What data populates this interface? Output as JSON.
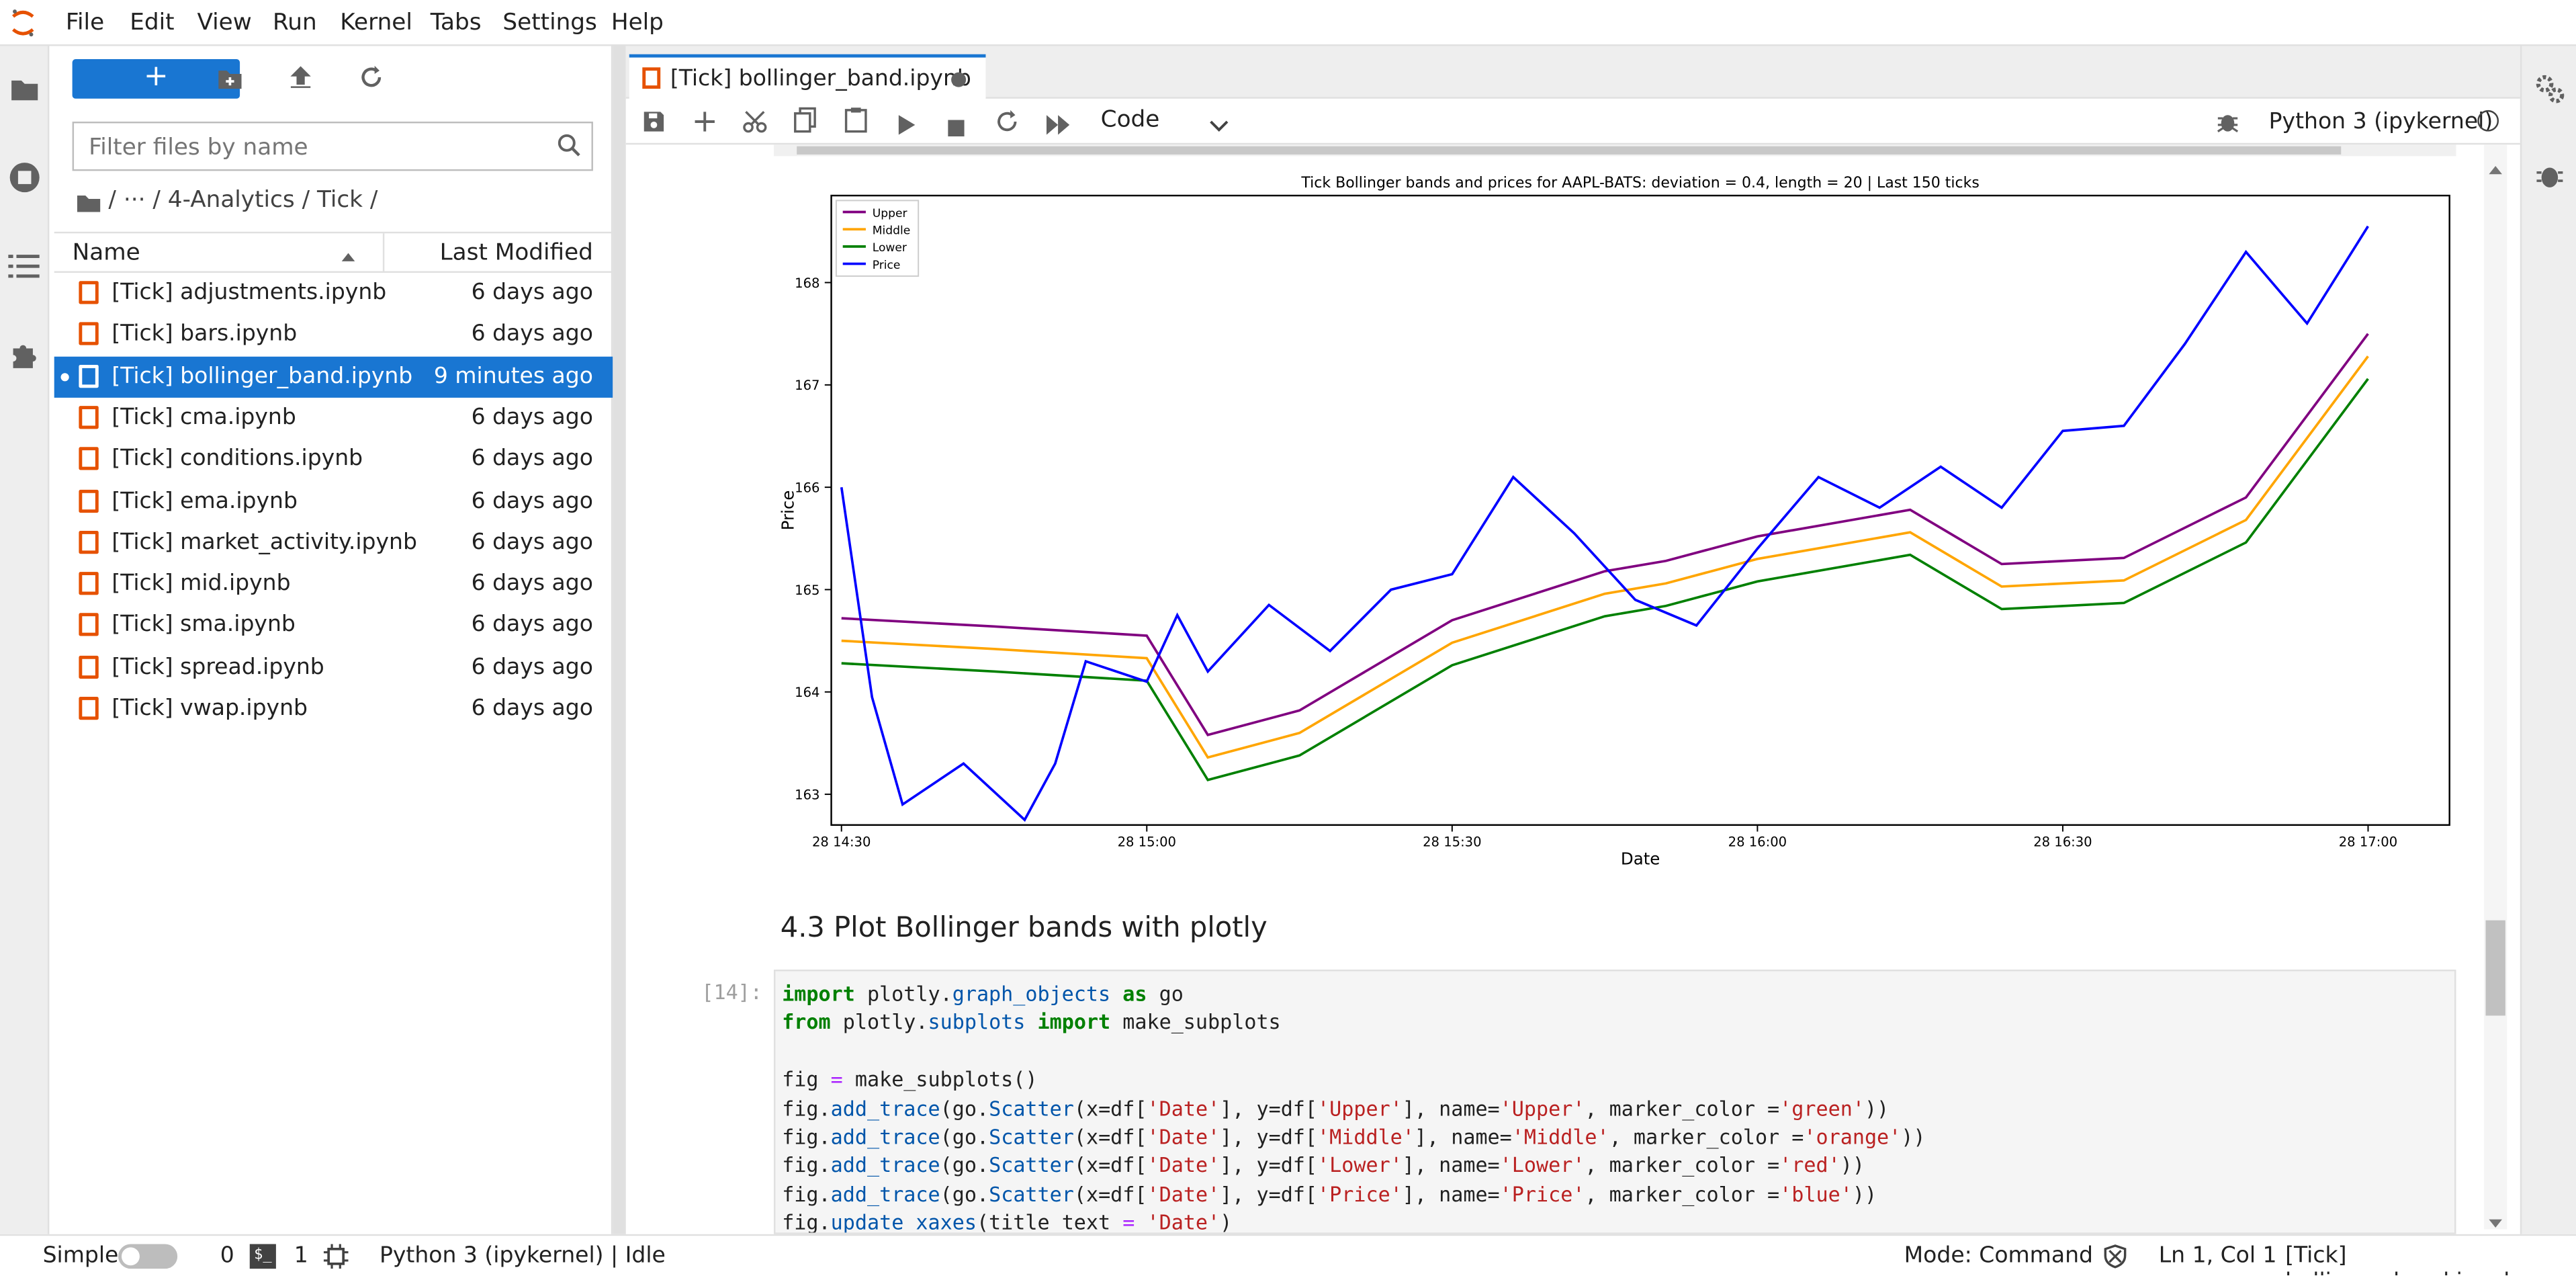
{
  "menu": [
    "File",
    "Edit",
    "View",
    "Run",
    "Kernel",
    "Tabs",
    "Settings",
    "Help"
  ],
  "filepanel": {
    "new_label": "+",
    "filter_placeholder": "Filter files by name",
    "breadcrumb": "/  ···  / 4-Analytics / Tick /",
    "col_name": "Name",
    "col_modified": "Last Modified",
    "files": [
      {
        "name": "[Tick] adjustments.ipynb",
        "modified": "6 days ago"
      },
      {
        "name": "[Tick] bars.ipynb",
        "modified": "6 days ago"
      },
      {
        "name": "[Tick] bollinger_band.ipynb",
        "modified": "9 minutes ago"
      },
      {
        "name": "[Tick] cma.ipynb",
        "modified": "6 days ago"
      },
      {
        "name": "[Tick] conditions.ipynb",
        "modified": "6 days ago"
      },
      {
        "name": "[Tick] ema.ipynb",
        "modified": "6 days ago"
      },
      {
        "name": "[Tick] market_activity.ipynb",
        "modified": "6 days ago"
      },
      {
        "name": "[Tick] mid.ipynb",
        "modified": "6 days ago"
      },
      {
        "name": "[Tick] sma.ipynb",
        "modified": "6 days ago"
      },
      {
        "name": "[Tick] spread.ipynb",
        "modified": "6 days ago"
      },
      {
        "name": "[Tick] vwap.ipynb",
        "modified": "6 days ago"
      }
    ]
  },
  "tab": {
    "label": "[Tick] bollinger_band.ipynb"
  },
  "toolbar": {
    "cell_type": "Code",
    "kernel": "Python 3 (ipykernel)"
  },
  "notebook": {
    "heading": "4.3 Plot Bollinger bands with plotly",
    "prompt": "[14]:"
  },
  "statusbar": {
    "mode_label": "Simple",
    "terminals": "0",
    "kernels": "1",
    "kernel_status": "Python 3 (ipykernel) | Idle",
    "mode": "Mode: Command",
    "position": "Ln 1, Col 1",
    "file": "[Tick] bollinger_band.ipynb"
  },
  "colors": {
    "accent": "#1976d2",
    "notebook_icon": "#e65100",
    "upper": "#800080",
    "middle": "#ffa500",
    "lower": "#008000",
    "price": "#0000ff"
  },
  "chart_data": {
    "type": "line",
    "title": "Tick Bollinger bands and prices for AAPL-BATS: deviation = 0.4, length = 20 | Last 150 ticks",
    "xlabel": "Date",
    "ylabel": "Price",
    "x_ticks": [
      "28 14:30",
      "28 15:00",
      "28 15:30",
      "28 16:00",
      "28 16:30",
      "28 17:00"
    ],
    "y_ticks": [
      "163",
      "164",
      "165",
      "166",
      "167",
      "168"
    ],
    "xlim": [
      "28 14:29",
      "28 17:08"
    ],
    "ylim": [
      162.7,
      168.85
    ],
    "legend_position": "top-left",
    "series": [
      {
        "name": "Upper",
        "color": "#800080",
        "x": [
          14.5,
          14.75,
          15.0,
          15.1,
          15.25,
          15.5,
          15.75,
          15.85,
          16.0,
          16.25,
          16.4,
          16.6,
          16.8,
          17.0
        ],
        "values": [
          164.72,
          164.64,
          164.55,
          163.58,
          163.82,
          164.7,
          165.18,
          165.28,
          165.52,
          165.78,
          165.25,
          165.31,
          165.9,
          167.5
        ]
      },
      {
        "name": "Middle",
        "color": "#ffa500",
        "x": [
          14.5,
          14.75,
          15.0,
          15.1,
          15.25,
          15.5,
          15.75,
          15.85,
          16.0,
          16.25,
          16.4,
          16.6,
          16.8,
          17.0
        ],
        "values": [
          164.5,
          164.42,
          164.33,
          163.36,
          163.6,
          164.48,
          164.96,
          165.06,
          165.3,
          165.56,
          165.03,
          165.09,
          165.68,
          167.28
        ]
      },
      {
        "name": "Lower",
        "color": "#008000",
        "x": [
          14.5,
          14.75,
          15.0,
          15.1,
          15.25,
          15.5,
          15.75,
          15.85,
          16.0,
          16.25,
          16.4,
          16.6,
          16.8,
          17.0
        ],
        "values": [
          164.28,
          164.2,
          164.11,
          163.14,
          163.38,
          164.26,
          164.74,
          164.84,
          165.08,
          165.34,
          164.81,
          164.87,
          165.46,
          167.06
        ]
      },
      {
        "name": "Price",
        "color": "#0000ff",
        "x": [
          14.5,
          14.55,
          14.6,
          14.7,
          14.8,
          14.85,
          14.9,
          15.0,
          15.05,
          15.1,
          15.2,
          15.3,
          15.4,
          15.5,
          15.6,
          15.7,
          15.8,
          15.9,
          16.0,
          16.1,
          16.2,
          16.3,
          16.4,
          16.5,
          16.6,
          16.7,
          16.8,
          16.9,
          17.0
        ],
        "values": [
          166.0,
          163.95,
          162.9,
          163.3,
          162.75,
          163.3,
          164.3,
          164.1,
          164.75,
          164.2,
          164.85,
          164.4,
          165.0,
          165.15,
          166.1,
          165.55,
          164.9,
          164.65,
          165.4,
          166.1,
          165.8,
          166.2,
          165.8,
          166.55,
          166.6,
          167.4,
          168.3,
          167.6,
          168.55
        ]
      }
    ]
  },
  "code_lines": [
    "import plotly.graph_objects as go",
    "from plotly.subplots import make_subplots",
    "",
    "fig = make_subplots()",
    "fig.add_trace(go.Scatter(x=df['Date'], y=df['Upper'], name='Upper', marker_color ='green'))",
    "fig.add_trace(go.Scatter(x=df['Date'], y=df['Middle'], name='Middle', marker_color ='orange'))",
    "fig.add_trace(go.Scatter(x=df['Date'], y=df['Lower'], name='Lower', marker_color ='red'))",
    "fig.add_trace(go.Scatter(x=df['Date'], y=df['Price'], name='Price', marker_color ='blue'))",
    "fig.update_xaxes(title_text = 'Date')"
  ]
}
